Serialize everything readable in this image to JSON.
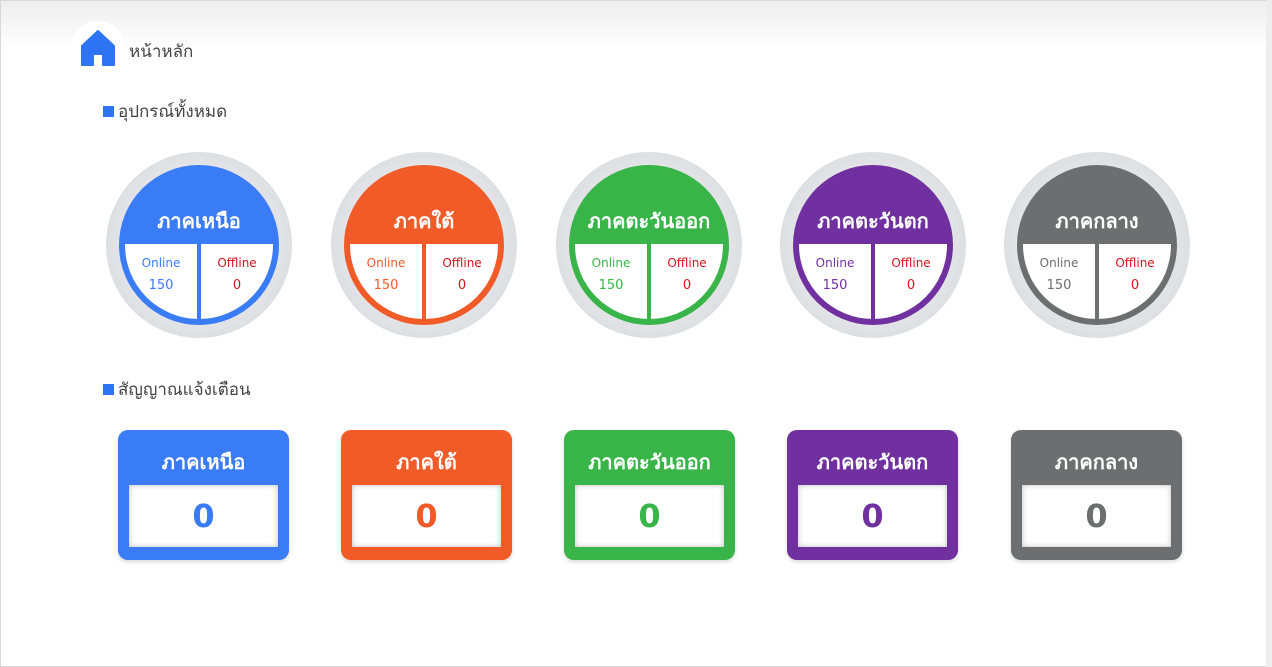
{
  "header": {
    "title": "หน้าหลัก",
    "icon": "home-icon",
    "icon_color": "#2f74f5"
  },
  "devices": {
    "title": "อุปกรณ์ทั้งหมด",
    "regions": [
      {
        "name": "ภาคเหนือ",
        "color": "#3a7cf5",
        "online_label": "Online",
        "online": "150",
        "offline_label": "Offline",
        "offline": "0"
      },
      {
        "name": "ภาคใต้",
        "color": "#f05b27",
        "online_label": "Online",
        "online": "150",
        "offline_label": "Offline",
        "offline": "0"
      },
      {
        "name": "ภาคตะวันออก",
        "color": "#38b448",
        "online_label": "Online",
        "online": "150",
        "offline_label": "Offline",
        "offline": "0"
      },
      {
        "name": "ภาคตะวันตก",
        "color": "#7030a0",
        "online_label": "Online",
        "online": "150",
        "offline_label": "Offline",
        "offline": "0"
      },
      {
        "name": "ภาคกลาง",
        "color": "#6d6e70",
        "online_label": "Online",
        "online": "150",
        "offline_label": "Offline",
        "offline": "0"
      }
    ]
  },
  "alerts": {
    "title": "สัญญาณแจ้งเตือน",
    "regions": [
      {
        "name": "ภาคเหนือ",
        "color": "#3a7cf5",
        "count": "0"
      },
      {
        "name": "ภาคใต้",
        "color": "#f05b27",
        "count": "0"
      },
      {
        "name": "ภาคตะวันออก",
        "color": "#38b448",
        "count": "0"
      },
      {
        "name": "ภาคตะวันตก",
        "color": "#7030a0",
        "count": "0"
      },
      {
        "name": "ภาคกลาง",
        "color": "#6d6e70",
        "count": "0"
      }
    ]
  }
}
